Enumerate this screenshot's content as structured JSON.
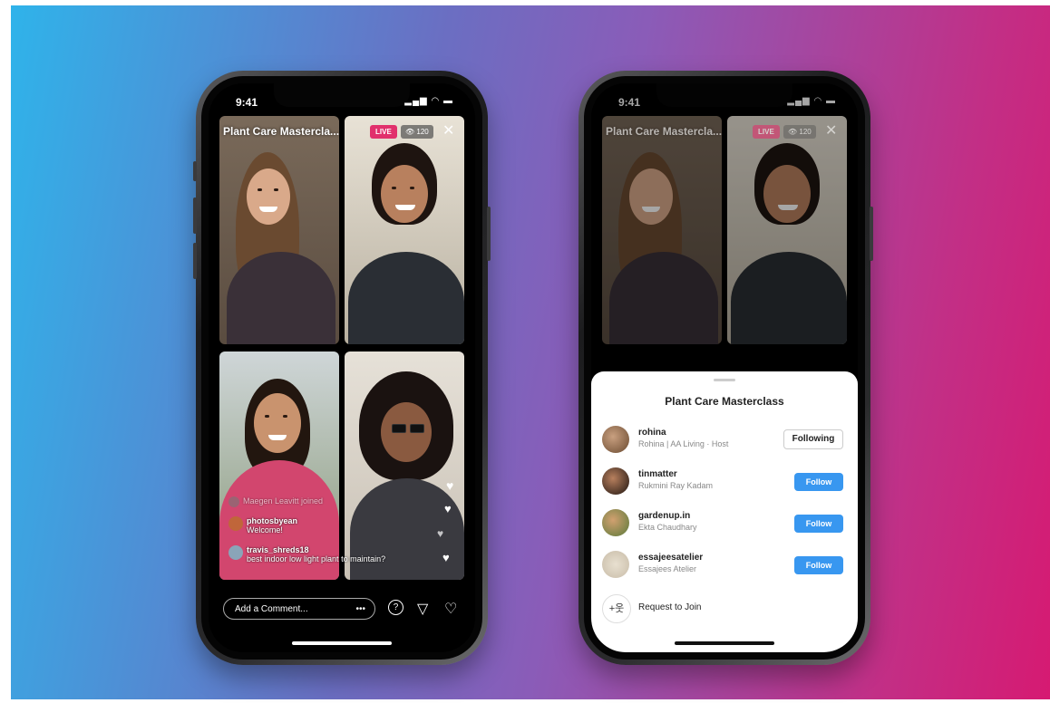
{
  "status": {
    "time": "9:41",
    "icons": "▂▄▆ ◠ ▬"
  },
  "live": {
    "title": "Plant Care Mastercla...",
    "badge": "LIVE",
    "viewers": "👁 120",
    "close": "✕",
    "comments": [
      {
        "username": "Maegen Leavitt joined",
        "text": ""
      },
      {
        "username": "photosbyean",
        "text": "Welcome!"
      },
      {
        "username": "travis_shreds18",
        "text": "best indoor low light plant to maintain?"
      }
    ],
    "input_placeholder": "Add a Comment...",
    "input_more": "•••",
    "icons": {
      "question": "?",
      "share": "▽",
      "heart": "♡"
    },
    "colors": {
      "live_badge": "#e1306c"
    }
  },
  "sheet": {
    "title": "Plant Care Masterclass",
    "rows": [
      {
        "username": "rohina",
        "name": "Rohina | AA Living · Host",
        "button": "Following"
      },
      {
        "username": "tinmatter",
        "name": "Rukmini Ray Kadam",
        "button": "Follow"
      },
      {
        "username": "gardenup.in",
        "name": "Ekta Chaudhary",
        "button": "Follow"
      },
      {
        "username": "essajeesatelier",
        "name": "Essajees Atelier",
        "button": "Follow"
      }
    ],
    "request": {
      "icon": "+웃",
      "label": "Request to Join"
    },
    "colors": {
      "follow": "#3897f0"
    }
  }
}
